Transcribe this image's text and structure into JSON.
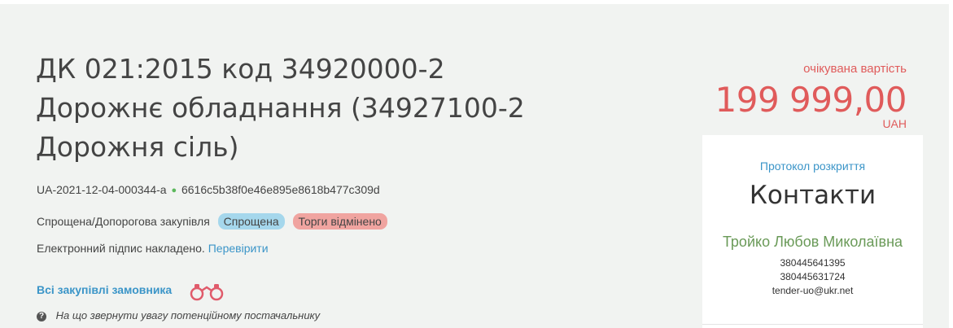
{
  "tender": {
    "title": "ДК 021:2015 код 34920000-2 Дорожнє обладнання (34927100-2 Дорожня сіль)",
    "tender_id": "UA-2021-12-04-000344-a",
    "separator_dot": "●",
    "hash": "6616c5b38f0e46e895e8618b477c309d",
    "procedure_type": "Спрощена/Допорогова закупівля",
    "badge_type": "Спрощена",
    "badge_status": "Торги відмінено",
    "signature_text": "Електронний підпис накладено.",
    "signature_link": "Перевірити",
    "all_purchases_link": "Всі закупівлі замовника",
    "hint_text": "На що звернути увагу потенційному постачальнику",
    "hint_icon": "?"
  },
  "price": {
    "label": "очікувана вартість",
    "value": "199 999,00",
    "currency": "UAH"
  },
  "contacts": {
    "protocol_link": "Протокол розкриття",
    "title": "Контакти",
    "name": "Тройко Любов Миколаївна",
    "phone1": "380445641395",
    "phone2": "380445631724",
    "email": "tender-uo@ukr.net"
  },
  "colors": {
    "panel_bg": "#f1f3f1",
    "link": "#3b95c8",
    "price": "#e05b5b",
    "contact_name": "#6a9a58",
    "badge_blue": "#a5d7ec",
    "badge_red": "#f0a4a0"
  },
  "icons": {
    "binoculars": "binoculars-icon",
    "question": "question-circle-icon"
  }
}
